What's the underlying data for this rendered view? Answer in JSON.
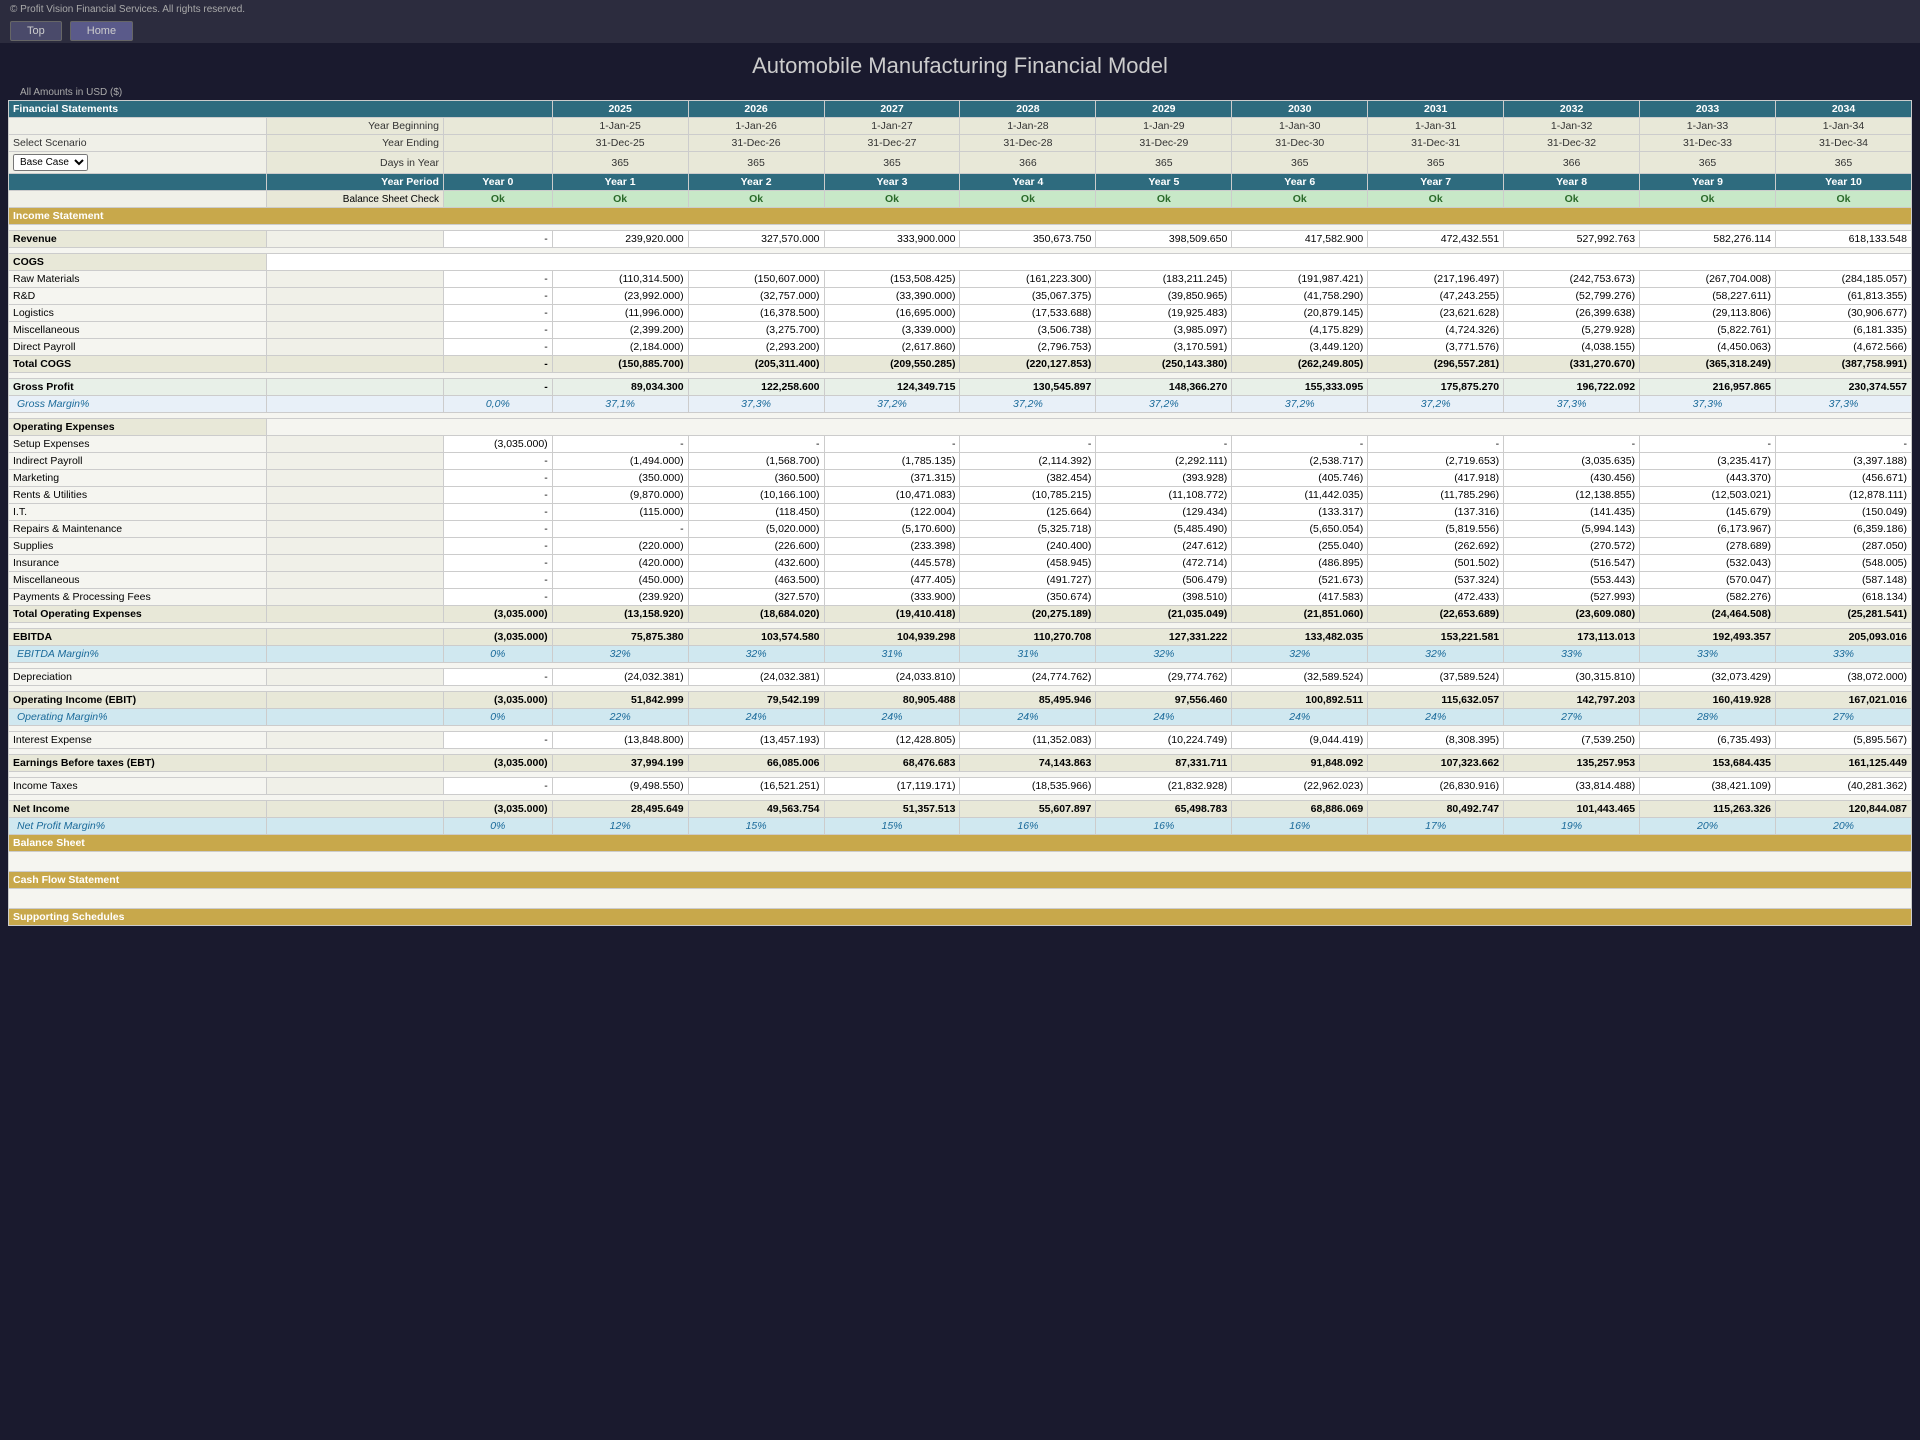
{
  "app": {
    "copyright": "© Profit Vision Financial Services. All rights reserved.",
    "nav": [
      "Top",
      "Home"
    ],
    "title": "Automobile Manufacturing Financial Model",
    "currency": "All Amounts in USD ($)"
  },
  "header": {
    "financial_statements": "Financial Statements",
    "select_scenario": "Select Scenario",
    "scenario_value": "Base Case",
    "year_beginning": "Year Beginning",
    "year_ending": "Year Ending",
    "days_in_year": "Days in Year",
    "year_period": "Year Period",
    "balance_sheet_check": "Balance Sheet Check",
    "years": [
      "2025",
      "2026",
      "2027",
      "2028",
      "2029",
      "2030",
      "2031",
      "2032",
      "2033",
      "2034"
    ],
    "year_begin_dates": [
      "1-Jan-25",
      "1-Jan-26",
      "1-Jan-27",
      "1-Jan-28",
      "1-Jan-29",
      "1-Jan-30",
      "1-Jan-31",
      "1-Jan-32",
      "1-Jan-33",
      "1-Jan-34"
    ],
    "year_end_dates": [
      "31-Dec-25",
      "31-Dec-26",
      "31-Dec-27",
      "31-Dec-28",
      "31-Dec-29",
      "31-Dec-30",
      "31-Dec-31",
      "31-Dec-32",
      "31-Dec-33",
      "31-Dec-34"
    ],
    "days": [
      "365",
      "365",
      "365",
      "366",
      "365",
      "365",
      "365",
      "366",
      "365",
      "365"
    ],
    "year_labels": [
      "Year 0",
      "Year 1",
      "Year 2",
      "Year 3",
      "Year 4",
      "Year 5",
      "Year 6",
      "Year 7",
      "Year 8",
      "Year 9",
      "Year 10"
    ],
    "ok_values": [
      "Ok",
      "Ok",
      "Ok",
      "Ok",
      "Ok",
      "Ok",
      "Ok",
      "Ok",
      "Ok",
      "Ok",
      "Ok"
    ]
  },
  "income_statement": {
    "title": "Income Statement",
    "revenue_label": "Revenue",
    "revenue_year0": "-",
    "revenue": [
      "239,920.000",
      "327,570.000",
      "333,900.000",
      "350,673.750",
      "398,509.650",
      "417,582.900",
      "472,432.551",
      "527,992.763",
      "582,276.114",
      "618,133.548"
    ],
    "cogs_label": "COGS",
    "raw_materials_label": "Raw Materials",
    "raw_materials_year0": "-",
    "raw_materials": [
      "(110,314.500)",
      "(150,607.000)",
      "(153,508.425)",
      "(161,223.300)",
      "(183,211.245)",
      "(191,987.421)",
      "(217,196.497)",
      "(242,753.673)",
      "(267,704.008)",
      "(284,185.057)"
    ],
    "rd_label": "R&D",
    "rd_year0": "-",
    "rd": [
      "(23,992.000)",
      "(32,757.000)",
      "(33,390.000)",
      "(35,067.375)",
      "(39,850.965)",
      "(41,758.290)",
      "(47,243.255)",
      "(52,799.276)",
      "(58,227.611)",
      "(61,813.355)"
    ],
    "logistics_label": "Logistics",
    "logistics_year0": "-",
    "logistics": [
      "(11,996.000)",
      "(16,378.500)",
      "(16,695.000)",
      "(17,533.688)",
      "(19,925.483)",
      "(20,879.145)",
      "(23,621.628)",
      "(26,399.638)",
      "(29,113.806)",
      "(30,906.677)"
    ],
    "miscellaneous_label": "Miscellaneous",
    "miscellaneous_year0": "-",
    "miscellaneous": [
      "(2,399.200)",
      "(3,275.700)",
      "(3,339.000)",
      "(3,506.738)",
      "(3,985.097)",
      "(4,175.829)",
      "(4,724.326)",
      "(5,279.928)",
      "(5,822.761)",
      "(6,181.335)"
    ],
    "direct_payroll_label": "Direct Payroll",
    "direct_payroll_year0": "-",
    "direct_payroll": [
      "(2,184.000)",
      "(2,293.200)",
      "(2,617.860)",
      "(2,796.753)",
      "(3,170.591)",
      "(3,449.120)",
      "(3,771.576)",
      "(4,038.155)",
      "(4,450.063)",
      "(4,672.566)"
    ],
    "total_cogs_label": "Total COGS",
    "total_cogs_year0": "-",
    "total_cogs": [
      "(150,885.700)",
      "(205,311.400)",
      "(209,550.285)",
      "(220,127.853)",
      "(250,143.380)",
      "(262,249.805)",
      "(296,557.281)",
      "(331,270.670)",
      "(365,318.249)",
      "(387,758.991)"
    ],
    "gross_profit_label": "Gross Profit",
    "gross_profit_year0": "-",
    "gross_profit": [
      "89,034.300",
      "122,258.600",
      "124,349.715",
      "130,545.897",
      "148,366.270",
      "155,333.095",
      "175,875.270",
      "196,722.092",
      "216,957.865",
      "230,374.557"
    ],
    "gross_margin_label": "Gross Margin%",
    "gross_margin_year0": "0,0%",
    "gross_margin": [
      "37,1%",
      "37,3%",
      "37,2%",
      "37,2%",
      "37,2%",
      "37,2%",
      "37,2%",
      "37,3%",
      "37,3%",
      "37,3%"
    ],
    "operating_expenses_label": "Operating Expenses",
    "setup_label": "Setup Expenses",
    "setup_year0": "(3,035.000)",
    "setup": [
      "-",
      "-",
      "-",
      "-",
      "-",
      "-",
      "-",
      "-",
      "-",
      "-"
    ],
    "indirect_payroll_label": "Indirect Payroll",
    "indirect_payroll_year0": "-",
    "indirect_payroll": [
      "(1,494.000)",
      "(1,568.700)",
      "(1,785.135)",
      "(2,114.392)",
      "(2,292.111)",
      "(2,538.717)",
      "(2,719.653)",
      "(3,035.635)",
      "(3,235.417)",
      "(3,397.188)"
    ],
    "marketing_label": "Marketing",
    "marketing_year0": "-",
    "marketing": [
      "(350.000)",
      "(360.500)",
      "(371.315)",
      "(382.454)",
      "(393.928)",
      "(405.746)",
      "(417.918)",
      "(430.456)",
      "(443.370)",
      "(456.671)"
    ],
    "rents_label": "Rents & Utilities",
    "rents_year0": "-",
    "rents": [
      "(9,870.000)",
      "(10,166.100)",
      "(10,471.083)",
      "(10,785.215)",
      "(11,108.772)",
      "(11,442.035)",
      "(11,785.296)",
      "(12,138.855)",
      "(12,503.021)",
      "(12,878.111)"
    ],
    "it_label": "I.T.",
    "it_year0": "-",
    "it": [
      "(115.000)",
      "(118.450)",
      "(122.004)",
      "(125.664)",
      "(129.434)",
      "(133.317)",
      "(137.316)",
      "(141.435)",
      "(145.679)",
      "(150.049)"
    ],
    "repairs_label": "Repairs & Maintenance",
    "repairs_year0": "-",
    "repairs": [
      "-",
      "(5,020.000)",
      "(5,170.600)",
      "(5,325.718)",
      "(5,485.490)",
      "(5,650.054)",
      "(5,819.556)",
      "(5,994.143)",
      "(6,173.967)",
      "(6,359.186)"
    ],
    "supplies_label": "Supplies",
    "supplies_year0": "-",
    "supplies": [
      "(220.000)",
      "(226.600)",
      "(233.398)",
      "(240.400)",
      "(247.612)",
      "(255.040)",
      "(262.692)",
      "(270.572)",
      "(278.689)",
      "(287.050)"
    ],
    "insurance_label": "Insurance",
    "insurance_year0": "-",
    "insurance": [
      "(420.000)",
      "(432.600)",
      "(445.578)",
      "(458.945)",
      "(472.714)",
      "(486.895)",
      "(501.502)",
      "(516.547)",
      "(532.043)",
      "(548.005)"
    ],
    "miscellaneous2_label": "Miscellaneous",
    "miscellaneous2_year0": "-",
    "miscellaneous2": [
      "(450.000)",
      "(463.500)",
      "(477.405)",
      "(491.727)",
      "(506.479)",
      "(521.673)",
      "(537.324)",
      "(553.443)",
      "(570.047)",
      "(587.148)"
    ],
    "payments_label": "Payments & Processing Fees",
    "payments_year0": "-",
    "payments": [
      "(239.920)",
      "(327.570)",
      "(333.900)",
      "(350.674)",
      "(398.510)",
      "(417.583)",
      "(472.433)",
      "(527.993)",
      "(582.276)",
      "(618.134)"
    ],
    "total_opex_label": "Total Operating Expenses",
    "total_opex_year0": "(3,035.000)",
    "total_opex": [
      "(13,158.920)",
      "(18,684.020)",
      "(19,410.418)",
      "(20,275.189)",
      "(21,035.049)",
      "(21,851.060)",
      "(22,653.689)",
      "(23,609.080)",
      "(24,464.508)",
      "(25,281.541)"
    ],
    "ebitda_label": "EBITDA",
    "ebitda_year0": "(3,035.000)",
    "ebitda": [
      "75,875.380",
      "103,574.580",
      "104,939.298",
      "110,270.708",
      "127,331.222",
      "133,482.035",
      "153,221.581",
      "173,113.013",
      "192,493.357",
      "205,093.016"
    ],
    "ebitda_margin_label": "EBITDA Margin%",
    "ebitda_margin_year0": "0%",
    "ebitda_margin": [
      "32%",
      "32%",
      "31%",
      "31%",
      "32%",
      "32%",
      "32%",
      "33%",
      "33%",
      "33%"
    ],
    "depreciation_label": "Depreciation",
    "depreciation_year0": "-",
    "depreciation": [
      "(24,032.381)",
      "(24,032.381)",
      "(24,033.810)",
      "(24,774.762)",
      "(29,774.762)",
      "(32,589.524)",
      "(37,589.524)",
      "(30,315.810)",
      "(32,073.429)",
      "(38,072.000)"
    ],
    "operating_income_label": "Operating Income (EBIT)",
    "operating_income_year0": "(3,035.000)",
    "operating_income": [
      "51,842.999",
      "79,542.199",
      "80,905.488",
      "85,495.946",
      "97,556.460",
      "100,892.511",
      "115,632.057",
      "142,797.203",
      "160,419.928",
      "167,021.016"
    ],
    "op_margin_label": "Operating Margin%",
    "op_margin_year0": "0%",
    "op_margin": [
      "22%",
      "24%",
      "24%",
      "24%",
      "24%",
      "24%",
      "24%",
      "27%",
      "28%",
      "27%"
    ],
    "interest_label": "Interest Expense",
    "interest_year0": "-",
    "interest": [
      "(13,848.800)",
      "(13,457.193)",
      "(12,428.805)",
      "(11,352.083)",
      "(10,224.749)",
      "(9,044.419)",
      "(8,308.395)",
      "(7,539.250)",
      "(6,735.493)",
      "(5,895.567)"
    ],
    "ebt_label": "Earnings Before taxes (EBT)",
    "ebt_year0": "(3,035.000)",
    "ebt": [
      "37,994.199",
      "66,085.006",
      "68,476.683",
      "74,143.863",
      "87,331.711",
      "91,848.092",
      "107,323.662",
      "135,257.953",
      "153,684.435",
      "161,125.449"
    ],
    "income_tax_label": "Income Taxes",
    "income_tax_year0": "-",
    "income_tax": [
      "(9,498.550)",
      "(16,521.251)",
      "(17,119.171)",
      "(18,535.966)",
      "(21,832.928)",
      "(22,962.023)",
      "(26,830.916)",
      "(33,814.488)",
      "(38,421.109)",
      "(40,281.362)"
    ],
    "net_income_label": "Net Income",
    "net_income_year0": "(3,035.000)",
    "net_income": [
      "28,495.649",
      "49,563.754",
      "51,357.513",
      "55,607.897",
      "65,498.783",
      "68,886.069",
      "80,492.747",
      "101,443.465",
      "115,263.326",
      "120,844.087"
    ],
    "net_margin_label": "Net Profit Margin%",
    "net_margin_year0": "0%",
    "net_margin": [
      "12%",
      "15%",
      "15%",
      "16%",
      "16%",
      "16%",
      "17%",
      "19%",
      "20%",
      "20%"
    ]
  },
  "sections": {
    "balance_sheet": "Balance Sheet",
    "cash_flow": "Cash Flow Statement",
    "supporting": "Supporting Schedules"
  }
}
